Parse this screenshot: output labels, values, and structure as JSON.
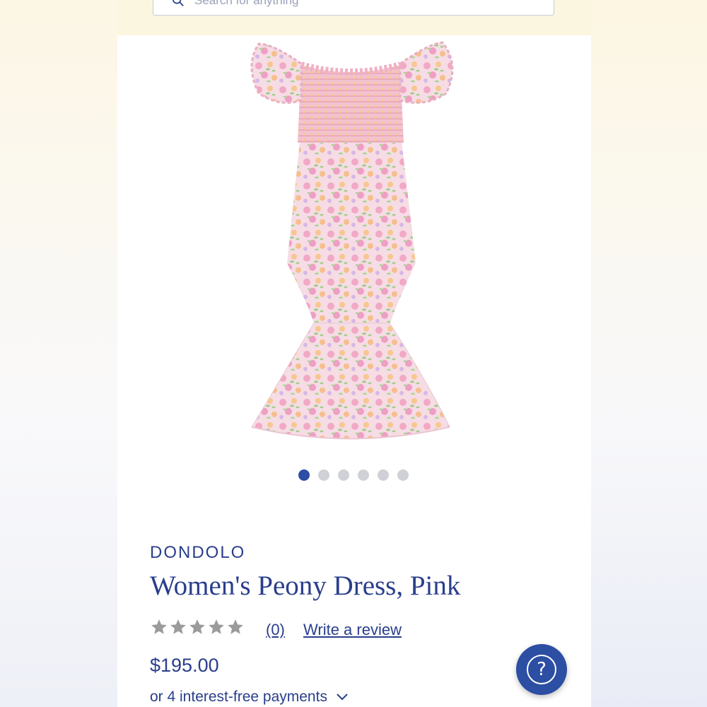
{
  "search": {
    "placeholder": "Search for anything"
  },
  "gallery": {
    "total_images": 6,
    "active_index": 0
  },
  "product": {
    "brand": "DONDOLO",
    "title": "Women's Peony Dress, Pink",
    "rating_stars": 0,
    "review_count": "(0)",
    "write_review_label": "Write a review",
    "price": "$195.00",
    "installments_label": "or 4 interest-free payments"
  },
  "help": {
    "icon": "?"
  },
  "colors": {
    "brand_blue": "#2a3e8c",
    "accent_blue": "#2c4ea3",
    "star_gray": "#9b9b9b",
    "dot_gray": "#d0d1d6"
  }
}
